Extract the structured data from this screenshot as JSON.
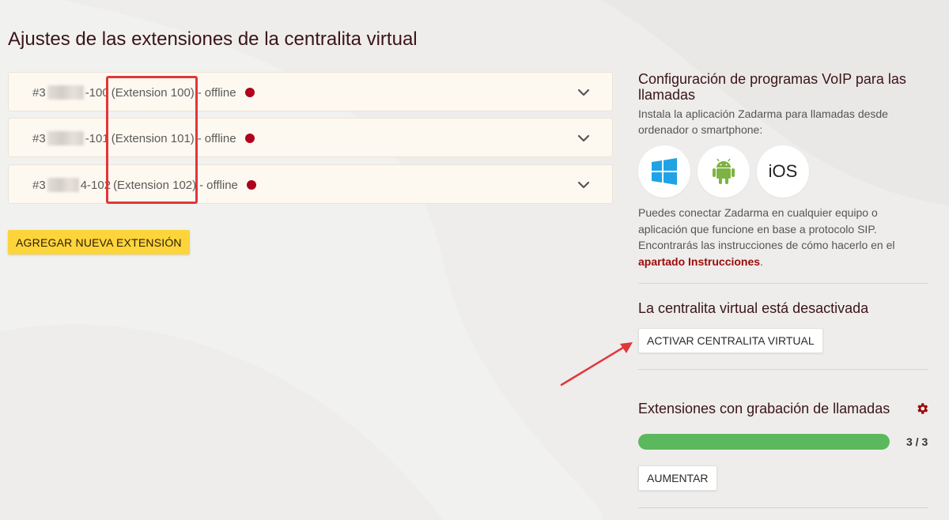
{
  "page": {
    "title": "Ajustes de las extensiones de la centralita virtual"
  },
  "extensions": [
    {
      "prefix": "#3",
      "suffix": "-100",
      "name": "(Extension 100)",
      "separator": "-",
      "status": "offline"
    },
    {
      "prefix": "#3",
      "suffix": "-101",
      "name": "(Extension 101)",
      "separator": "-",
      "status": "offline"
    },
    {
      "prefix": "#3",
      "suffix": "4-102",
      "name": "(Extension 102)",
      "separator": "-",
      "status": "offline"
    }
  ],
  "buttons": {
    "add_extension": "AGREGAR NUEVA EXTENSIÓN",
    "activate_pbx": "ACTIVAR CENTRALITA VIRTUAL",
    "increase": "AUMENTAR"
  },
  "voip": {
    "title": "Configuración de programas VoIP para las llamadas",
    "description": "Instala la aplicación Zadarma para llamadas desde ordenador o smartphone:",
    "apps": [
      "windows-icon",
      "android-icon",
      "ios-icon"
    ],
    "ios_label": "iOS",
    "sip_text": "Puedes conectar Zadarma en cualquier equipo o aplicación que funcione en base a protocolo SIP. Encontrarás las instrucciones de cómo hacerlo en el ",
    "instructions_link": "apartado Instrucciones",
    "sip_text_end": "."
  },
  "pbx": {
    "status_text": "La centralita virtual está desactivada"
  },
  "recording": {
    "title": "Extensiones con grabación de llamadas",
    "used": 3,
    "total": 3,
    "count_text": "3 / 3"
  },
  "colors": {
    "status_offline": "#b0001c",
    "accent_yellow": "#fdd53a",
    "progress_green": "#5cb85c",
    "link_red": "#9b0a0a",
    "highlight_red": "#e0373a"
  }
}
